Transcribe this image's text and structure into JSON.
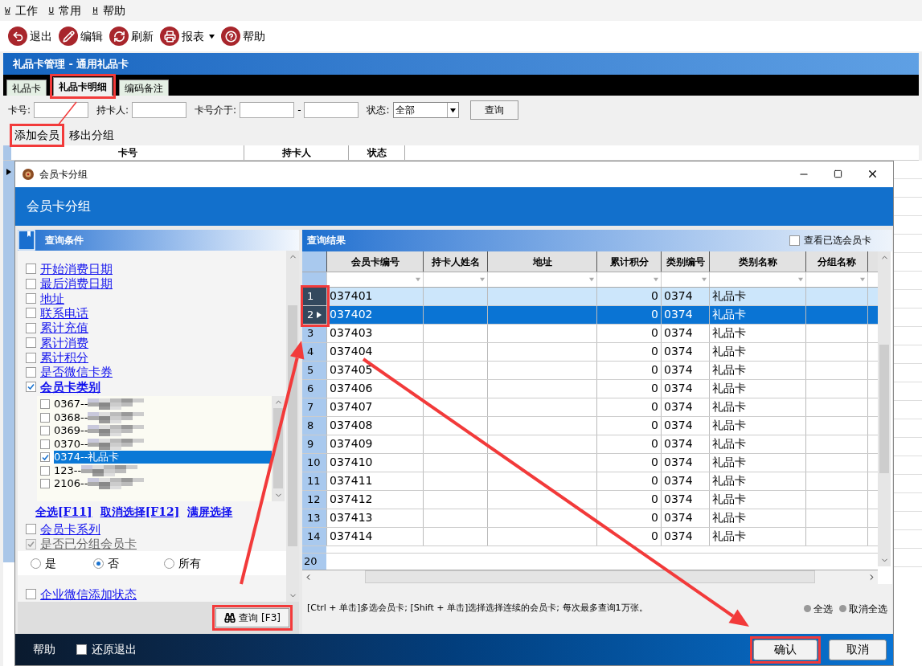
{
  "menu": [
    {
      "key": "W",
      "label": "工作"
    },
    {
      "key": "U",
      "label": "常用"
    },
    {
      "key": "H",
      "label": "帮助"
    }
  ],
  "toolbar": [
    {
      "kind": "exit",
      "label": "退出",
      "dropdown": false
    },
    {
      "kind": "edit",
      "label": "编辑",
      "dropdown": false
    },
    {
      "kind": "refresh",
      "label": "刷新",
      "dropdown": false
    },
    {
      "kind": "print",
      "label": "报表",
      "dropdown": true
    },
    {
      "kind": "help",
      "label": "帮助",
      "dropdown": false
    }
  ],
  "module_title": "礼品卡管理 - 通用礼品卡",
  "tabs": [
    {
      "label": "礼品卡",
      "selected": false
    },
    {
      "label": "礼品卡明细",
      "selected": true
    },
    {
      "label": "编码备注",
      "selected": false
    }
  ],
  "filters": {
    "card_no_label": "卡号:",
    "holder_label": "持卡人:",
    "range_label": "卡号介于:",
    "range_sep": "-",
    "status_label": "状态:",
    "status_value": "全部",
    "query_button": "查询"
  },
  "actions": [
    "添加会员",
    "移出分组"
  ],
  "table": {
    "columns": [
      "卡号",
      "持卡人",
      "状态"
    ]
  },
  "dialog": {
    "title": "会员卡分组",
    "header": "会员卡分组",
    "conditions": {
      "title": "查询条件",
      "query_button": "查询 [F3]",
      "items": [
        {
          "kind": "check",
          "label": "开始消费日期",
          "checked": false,
          "disabled": false
        },
        {
          "kind": "check",
          "label": "最后消费日期",
          "checked": false,
          "disabled": false
        },
        {
          "kind": "check",
          "label": "地址",
          "checked": false,
          "disabled": false
        },
        {
          "kind": "check",
          "label": "联系电话",
          "checked": false,
          "disabled": false
        },
        {
          "kind": "check",
          "label": "累计充值",
          "checked": false,
          "disabled": false
        },
        {
          "kind": "check",
          "label": "累计消费",
          "checked": false,
          "disabled": false
        },
        {
          "kind": "check",
          "label": "累计积分",
          "checked": false,
          "disabled": false
        },
        {
          "kind": "check",
          "label": "是否微信卡券",
          "checked": false,
          "disabled": false
        },
        {
          "kind": "category",
          "label": "会员卡类别",
          "checked": true,
          "disabled": false,
          "options": [
            {
              "label": "0367--",
              "checked": false,
              "selected": false,
              "redacted": true
            },
            {
              "label": "0368--",
              "checked": false,
              "selected": false,
              "redacted": true
            },
            {
              "label": "0369--",
              "checked": false,
              "selected": false,
              "redacted": true
            },
            {
              "label": "0370--",
              "checked": false,
              "selected": false,
              "redacted": true
            },
            {
              "label": "0374--礼品卡",
              "checked": true,
              "selected": true,
              "redacted": false
            },
            {
              "label": "123--",
              "checked": false,
              "selected": false,
              "redacted": true
            },
            {
              "label": "2106--",
              "checked": false,
              "selected": false,
              "redacted": true
            }
          ],
          "links": [
            "全选[F11]",
            "取消选择[F12]",
            "满屏选择"
          ]
        },
        {
          "kind": "check",
          "label": "会员卡系列",
          "checked": false,
          "disabled": false
        },
        {
          "kind": "check",
          "label": "是否已分组会员卡",
          "checked": true,
          "disabled": true
        },
        {
          "kind": "radio",
          "options": [
            {
              "label": "是",
              "selected": false
            },
            {
              "label": "否",
              "selected": true
            },
            {
              "label": "所有",
              "selected": false
            }
          ]
        },
        {
          "kind": "check",
          "label": "企业微信添加状态",
          "checked": false,
          "disabled": false
        }
      ]
    },
    "results": {
      "title": "查询结果",
      "show_selected": {
        "label": "查看已选会员卡",
        "checked": false
      },
      "columns": [
        "会员卡编号",
        "持卡人姓名",
        "地址",
        "累计积分",
        "类别编号",
        "类别名称",
        "分组名称"
      ],
      "rows": [
        {
          "no": "1",
          "card": "037401",
          "points": "0",
          "type_code": "0374",
          "type_name": "礼品卡",
          "selected": true,
          "current": false
        },
        {
          "no": "2",
          "card": "037402",
          "points": "0",
          "type_code": "0374",
          "type_name": "礼品卡",
          "selected": true,
          "current": true
        },
        {
          "no": "3",
          "card": "037403",
          "points": "0",
          "type_code": "0374",
          "type_name": "礼品卡",
          "selected": false,
          "current": false
        },
        {
          "no": "4",
          "card": "037404",
          "points": "0",
          "type_code": "0374",
          "type_name": "礼品卡",
          "selected": false,
          "current": false
        },
        {
          "no": "5",
          "card": "037405",
          "points": "0",
          "type_code": "0374",
          "type_name": "礼品卡",
          "selected": false,
          "current": false
        },
        {
          "no": "6",
          "card": "037406",
          "points": "0",
          "type_code": "0374",
          "type_name": "礼品卡",
          "selected": false,
          "current": false
        },
        {
          "no": "7",
          "card": "037407",
          "points": "0",
          "type_code": "0374",
          "type_name": "礼品卡",
          "selected": false,
          "current": false
        },
        {
          "no": "8",
          "card": "037408",
          "points": "0",
          "type_code": "0374",
          "type_name": "礼品卡",
          "selected": false,
          "current": false
        },
        {
          "no": "9",
          "card": "037409",
          "points": "0",
          "type_code": "0374",
          "type_name": "礼品卡",
          "selected": false,
          "current": false
        },
        {
          "no": "10",
          "card": "037410",
          "points": "0",
          "type_code": "0374",
          "type_name": "礼品卡",
          "selected": false,
          "current": false
        },
        {
          "no": "11",
          "card": "037411",
          "points": "0",
          "type_code": "0374",
          "type_name": "礼品卡",
          "selected": false,
          "current": false
        },
        {
          "no": "12",
          "card": "037412",
          "points": "0",
          "type_code": "0374",
          "type_name": "礼品卡",
          "selected": false,
          "current": false
        },
        {
          "no": "13",
          "card": "037413",
          "points": "0",
          "type_code": "0374",
          "type_name": "礼品卡",
          "selected": false,
          "current": false
        },
        {
          "no": "14",
          "card": "037414",
          "points": "0",
          "type_code": "0374",
          "type_name": "礼品卡",
          "selected": false,
          "current": false
        }
      ],
      "new_row": "20",
      "hint": "[Ctrl + 单击]多选会员卡; [Shift + 单击]选择选择连续的会员卡; 每次最多查询1万张。",
      "select_all": "全选",
      "deselect_all": "取消全选"
    },
    "footer": {
      "help": "帮助",
      "restore": {
        "label": "还原退出",
        "checked": false
      },
      "confirm": "确认",
      "cancel": "取消"
    }
  }
}
